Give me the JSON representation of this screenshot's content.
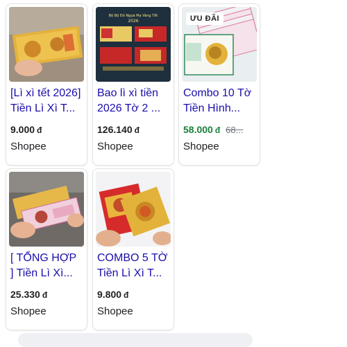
{
  "products": [
    {
      "title_lines": [
        "[Lì xì tết 2026]",
        "Tiền Lì Xì T..."
      ],
      "price": "9.000",
      "currency": "đ",
      "seller": "Shopee"
    },
    {
      "title_lines": [
        "Bao lì xì tiền",
        "2026 Tờ 2 ..."
      ],
      "price": "126.140",
      "currency": "đ",
      "seller": "Shopee",
      "image_text": [
        "Bộ Bộ Đỏ Ngựa Mạ Vàng Tết",
        "2026"
      ]
    },
    {
      "title_lines": [
        "Combo 10 Tờ",
        "Tiền Hình..."
      ],
      "price": "58.000",
      "currency": "đ",
      "old_price": "68...",
      "seller": "Shopee",
      "badge": "ƯU ĐÃI"
    },
    {
      "title_lines": [
        "[ TỔNG HỢP",
        "] Tiền Lì Xì..."
      ],
      "price": "25.330",
      "currency": "đ",
      "seller": "Shopee"
    },
    {
      "title_lines": [
        "COMBO 5 TỜ",
        "Tiền Lì Xì T..."
      ],
      "price": "9.800",
      "currency": "đ",
      "seller": "Shopee"
    }
  ],
  "colors": {
    "title_link": "#1a0dab",
    "sale_price": "#188038",
    "gold": "#e2b23a",
    "red": "#d62b2b"
  }
}
